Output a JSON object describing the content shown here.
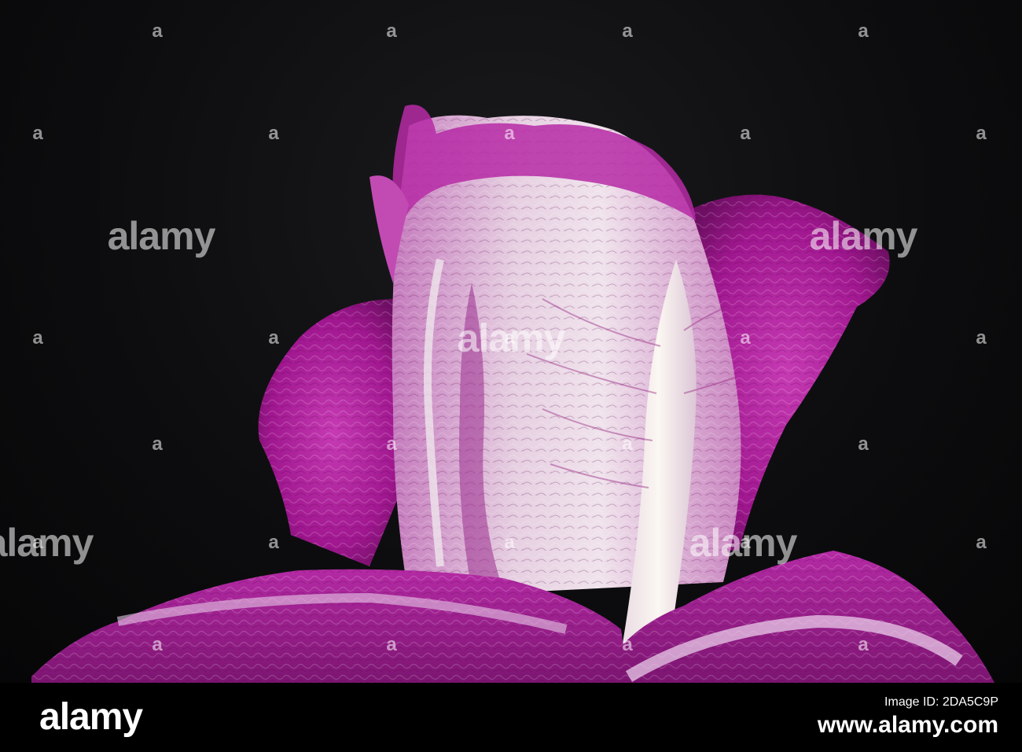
{
  "watermark": {
    "word": "alamy",
    "mark": "a"
  },
  "footer": {
    "brand": "alamy",
    "image_id": "Image ID: 2DA5C9P",
    "site": "www.alamy.com"
  },
  "colors": {
    "background": "#0d0d0f",
    "leaf_purple": "#b01fa0",
    "leaf_pale": "#e8d2e3",
    "rib_white": "#f2ece6"
  }
}
